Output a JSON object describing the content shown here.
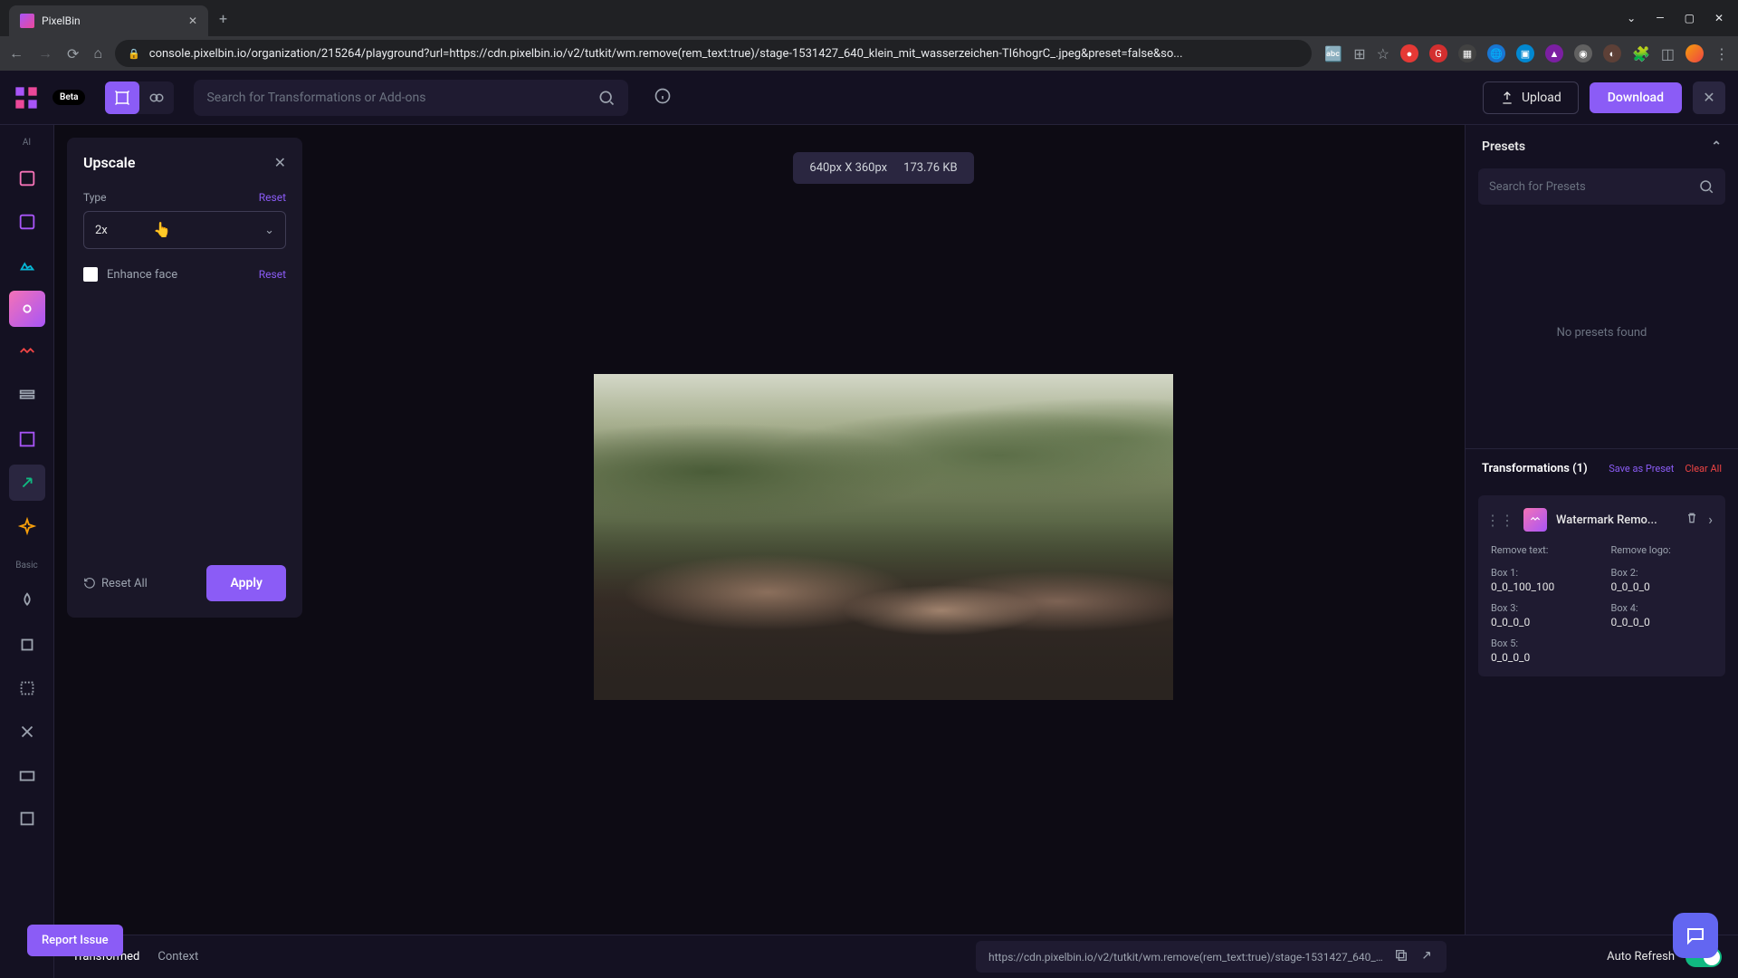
{
  "browser": {
    "tab_title": "PixelBin",
    "url": "console.pixelbin.io/organization/215264/playground?url=https://cdn.pixelbin.io/v2/tutkit/wm.remove(rem_text:true)/stage-1531427_640_klein_mit_wasserzeichen-TI6hogrC_.jpeg&preset=false&so..."
  },
  "header": {
    "beta": "Beta",
    "search_placeholder": "Search for Transformations or Add-ons",
    "upload": "Upload",
    "download": "Download"
  },
  "left_rail": {
    "ai_label": "AI",
    "basic_label": "Basic"
  },
  "panel": {
    "title": "Upscale",
    "type_label": "Type",
    "type_value": "2x",
    "reset": "Reset",
    "enhance_face": "Enhance face",
    "reset_all": "Reset All",
    "apply": "Apply"
  },
  "canvas": {
    "dimensions": "640px X 360px",
    "filesize": "173.76 KB"
  },
  "presets": {
    "title": "Presets",
    "search_placeholder": "Search for Presets",
    "empty": "No presets found"
  },
  "transforms": {
    "title": "Transformations (1)",
    "save_preset": "Save as Preset",
    "clear_all": "Clear All",
    "item": {
      "name": "Watermark Remo...",
      "params": [
        {
          "label": "Remove text:",
          "value": ""
        },
        {
          "label": "Remove logo:",
          "value": ""
        },
        {
          "label": "Box 1:",
          "value": "0_0_100_100"
        },
        {
          "label": "Box 2:",
          "value": "0_0_0_0"
        },
        {
          "label": "Box 3:",
          "value": "0_0_0_0"
        },
        {
          "label": "Box 4:",
          "value": "0_0_0_0"
        },
        {
          "label": "Box 5:",
          "value": "0_0_0_0"
        }
      ]
    }
  },
  "bottom": {
    "transformed": "Transformed",
    "context": "Context",
    "url": "https://cdn.pixelbin.io/v2/tutkit/wm.remove(rem_text:true)/stage-1531427_640_klei...",
    "auto_refresh": "Auto Refresh"
  },
  "report_issue": "Report Issue"
}
